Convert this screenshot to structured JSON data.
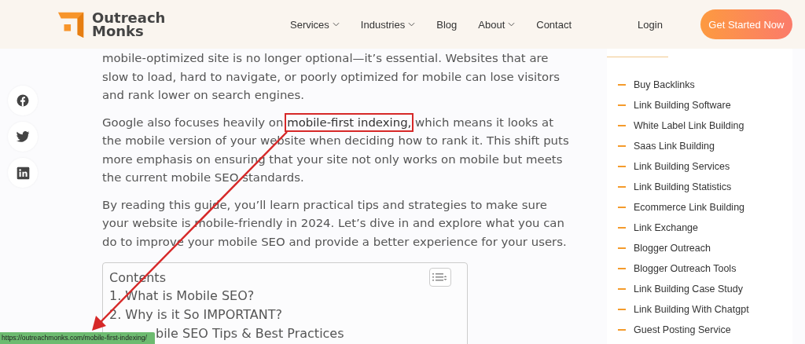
{
  "header": {
    "logo": {
      "line_1": "Outreach",
      "line_2": "Monks"
    },
    "nav": [
      {
        "label": "Services",
        "dropdown": true
      },
      {
        "label": "Industries",
        "dropdown": true
      },
      {
        "label": "Blog",
        "dropdown": false
      },
      {
        "label": "About",
        "dropdown": true
      },
      {
        "label": "Contact",
        "dropdown": false
      }
    ],
    "login": "Login",
    "cta": "Get Started Now"
  },
  "article": {
    "paragraphs": [
      {
        "before": "mobile-optimized site is no longer optional—it’s essential. Websites that are slow to load, hard to navigate, or poorly optimized for mobile can lose visitors and rank lower on search engines."
      },
      {
        "before": "Google also focuses heavily on ",
        "highlight": "mobile-first indexing,",
        "after": " which means it looks at the mobile version of your website when deciding how to rank it. This shift puts more emphasis on ensuring that your site not only works on mobile but meets the current mobile SEO standards."
      },
      {
        "before": "By reading this guide, you’ll learn practical tips and strategies to make sure your website is mobile-friendly in 2024. Let’s dive in and explore what you can do to improve your mobile SEO and provide a better experience for your users."
      }
    ],
    "contents": {
      "title": "Contents",
      "items": [
        {
          "text": "1. What is Mobile SEO?"
        },
        {
          "text": "2. Why is it So IMPORTANT?"
        },
        {
          "text": "bile SEO Tips & Best Practices",
          "covered": true
        }
      ]
    }
  },
  "sidebar": {
    "items": [
      "Buy Backlinks",
      "Link Building Software",
      "White Label Link Building",
      "Saas Link Building",
      "Link Building Services",
      "Link Building Statistics",
      "Ecommerce Link Building",
      "Link Exchange",
      "Blogger Outreach",
      "Blogger Outreach Tools",
      "Link Building Case Study",
      "Link Building With Chatgpt",
      "Guest Posting Service"
    ]
  },
  "status_bar": {
    "url": "https://outreachmonks.com/mobile-first-indexing/"
  }
}
